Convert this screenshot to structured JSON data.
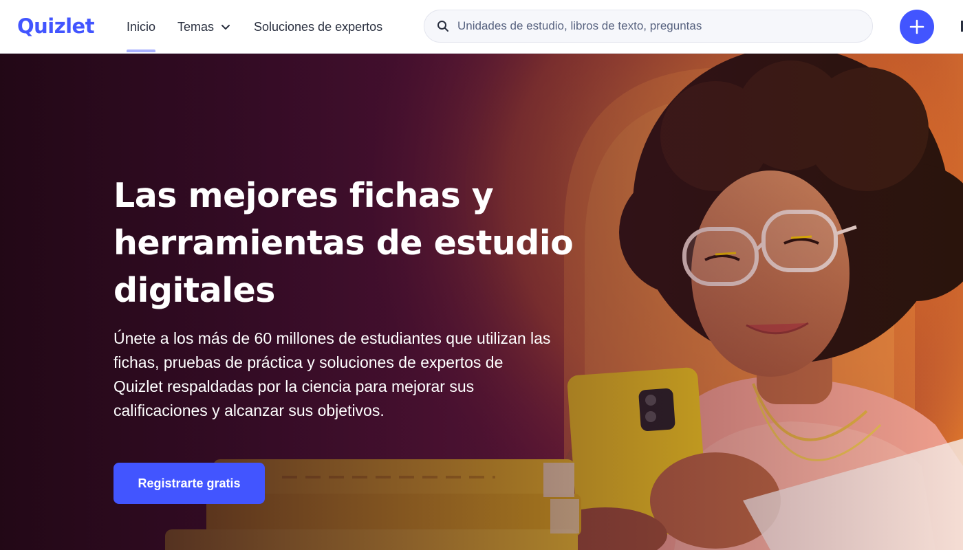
{
  "header": {
    "logo": "Quizlet",
    "nav": {
      "inicio": "Inicio",
      "temas": "Temas",
      "soluciones": "Soluciones de expertos"
    },
    "search": {
      "placeholder": "Unidades de estudio, libros de texto, preguntas"
    },
    "create_icon": "plus-icon"
  },
  "hero": {
    "title_lines": [
      "Las mejores fichas y",
      "herramientas de estudio",
      "digitales"
    ],
    "body_lines": [
      "Únete a los más de 60 millones de estudiantes que utilizan las",
      "fichas, pruebas de práctica y soluciones de expertos de",
      "Quizlet respaldadas por la ciencia para mejorar sus",
      "calificaciones y alcanzar sus objetivos."
    ],
    "cta_label": "Registrarte gratis"
  },
  "colors": {
    "brand": "#4255ff",
    "nav_text": "#282e3e",
    "active_indicator": "#a8b1ff",
    "hero_dark": "#2a0a1e",
    "hero_warm": "#e0782c"
  }
}
